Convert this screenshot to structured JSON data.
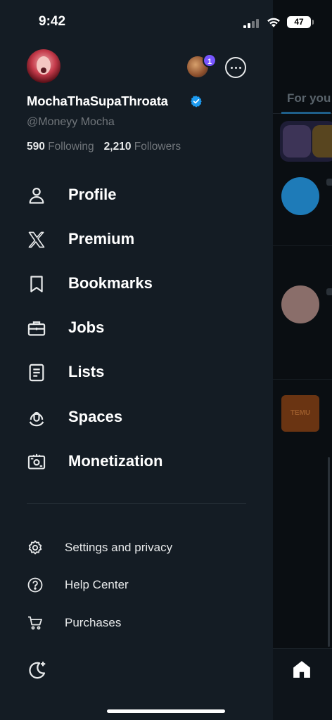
{
  "status_bar": {
    "time": "9:42",
    "battery": "47"
  },
  "profile": {
    "display_name": "MochaThaSupaThroata",
    "handle": "@Moneyy Mocha",
    "following_count": "590",
    "following_label": "Following",
    "followers_count": "2,210",
    "followers_label": "Followers",
    "account_badge": "1"
  },
  "nav": {
    "items": [
      {
        "label": "Profile",
        "icon": "person-icon"
      },
      {
        "label": "Premium",
        "icon": "x-logo-icon"
      },
      {
        "label": "Bookmarks",
        "icon": "bookmark-icon"
      },
      {
        "label": "Jobs",
        "icon": "briefcase-icon"
      },
      {
        "label": "Lists",
        "icon": "list-icon"
      },
      {
        "label": "Spaces",
        "icon": "spaces-mic-icon"
      },
      {
        "label": "Monetization",
        "icon": "money-icon"
      }
    ]
  },
  "secondary": {
    "items": [
      {
        "label": "Settings and privacy",
        "icon": "gear-icon"
      },
      {
        "label": "Help Center",
        "icon": "help-icon"
      },
      {
        "label": "Purchases",
        "icon": "cart-icon"
      }
    ]
  },
  "background": {
    "tab_label": "For you",
    "temu_label": "TEMU"
  },
  "colors": {
    "drawer_bg": "#141c24",
    "verified_blue": "#1d9bf0",
    "badge_purple": "#7856ff",
    "muted_text": "#71767b"
  }
}
